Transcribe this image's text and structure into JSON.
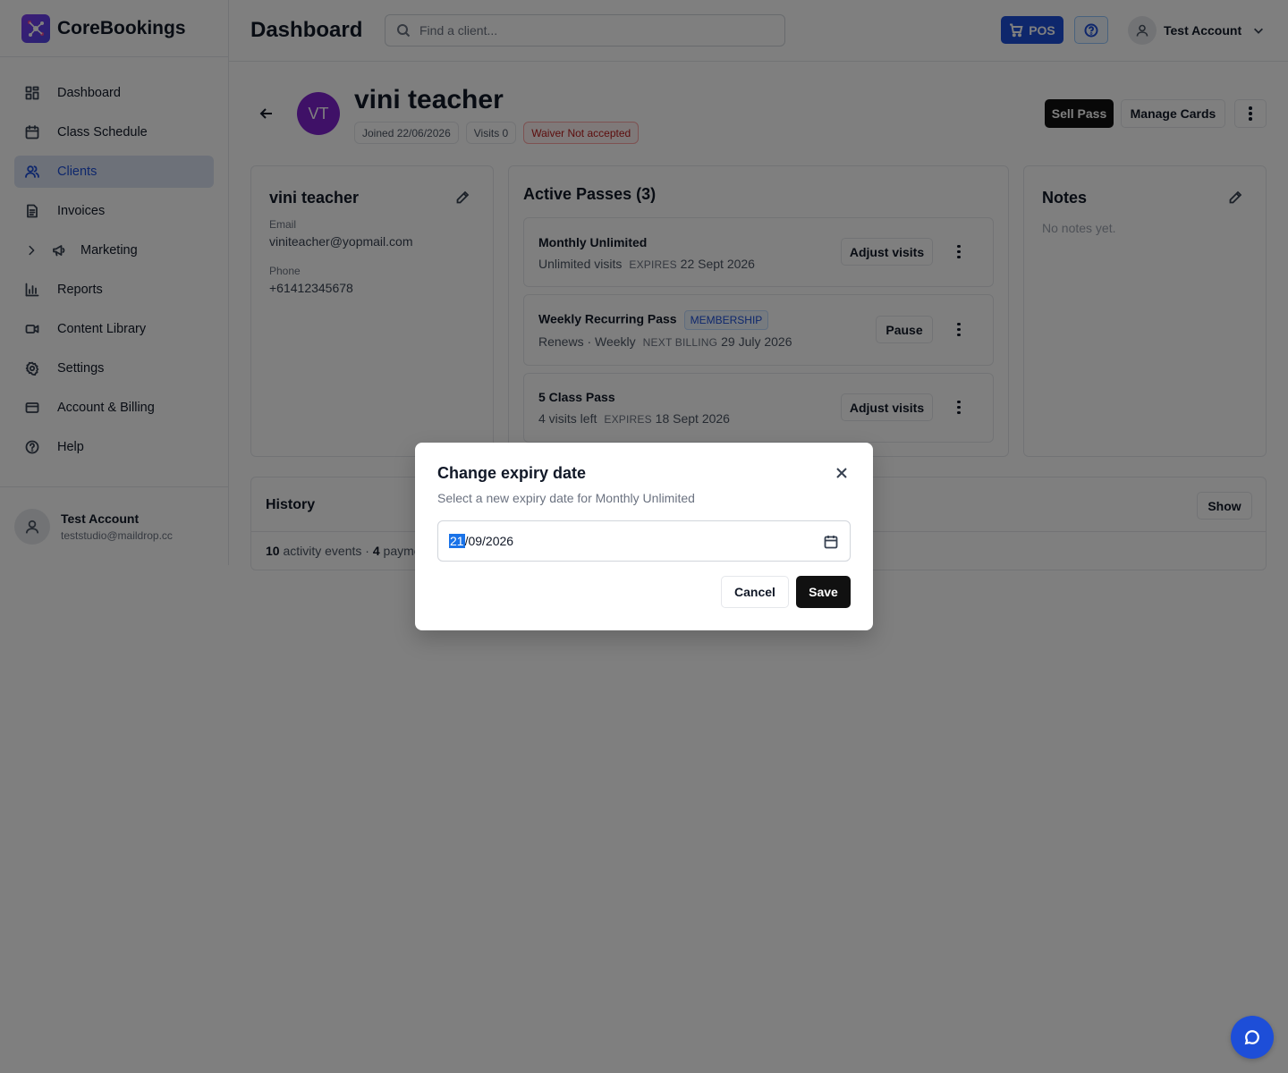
{
  "app": {
    "brand": "CoreBookings"
  },
  "sidebar": {
    "items": [
      {
        "label": "Dashboard",
        "icon": "dashboard-icon"
      },
      {
        "label": "Class Schedule",
        "icon": "calendar-icon"
      },
      {
        "label": "Clients",
        "icon": "users-icon",
        "active": true
      },
      {
        "label": "Invoices",
        "icon": "document-icon"
      },
      {
        "label": "Marketing",
        "icon": "megaphone-icon",
        "expandable": true
      },
      {
        "label": "Reports",
        "icon": "bar-chart-icon"
      },
      {
        "label": "Content Library",
        "icon": "video-icon"
      },
      {
        "label": "Settings",
        "icon": "gear-icon"
      },
      {
        "label": "Account & Billing",
        "icon": "credit-card-icon"
      },
      {
        "label": "Help",
        "icon": "help-circle-icon"
      }
    ],
    "user": {
      "name": "Test Account",
      "email": "teststudio@maildrop.cc"
    }
  },
  "header": {
    "title": "Dashboard",
    "search_placeholder": "Find a client...",
    "pos_label": "POS",
    "account_name": "Test Account"
  },
  "client": {
    "initials": "VT",
    "name": "vini teacher",
    "joined": "Joined 22/06/2026",
    "visits": "Visits 0",
    "waiver": "Waiver Not accepted",
    "sell_pass_label": "Sell Pass",
    "manage_cards_label": "Manage Cards",
    "email_label": "Email",
    "email": "viniteacher@yopmail.com",
    "phone_label": "Phone",
    "phone": "+61412345678"
  },
  "passes": {
    "title": "Active Passes (3)",
    "items": [
      {
        "name": "Monthly Unlimited",
        "meta": "Unlimited visits",
        "cap": "EXPIRES",
        "date": "22 Sept 2026",
        "action": "Adjust visits"
      },
      {
        "name": "Weekly Recurring Pass",
        "badge": "MEMBERSHIP",
        "meta": "Renews · Weekly",
        "cap": "NEXT BILLING",
        "date": "29 July 2026",
        "action": "Pause"
      },
      {
        "name": "5 Class Pass",
        "meta": "4 visits left",
        "cap": "EXPIRES",
        "date": "18 Sept 2026",
        "action": "Adjust visits"
      }
    ]
  },
  "notes": {
    "title": "Notes",
    "empty": "No notes yet."
  },
  "history": {
    "title": "History",
    "show_label": "Show",
    "events_count": "10",
    "events_label": " activity events · ",
    "payments_count": "4",
    "payments_label": " payme"
  },
  "modal": {
    "title": "Change expiry date",
    "subtitle": "Select a new expiry date for Monthly Unlimited",
    "date_day": "21",
    "date_rest": "/09/2026",
    "cancel_label": "Cancel",
    "save_label": "Save"
  },
  "colors": {
    "accent": "#1d4ed8",
    "avatar": "#7e22ce",
    "danger": "#b91c1c"
  }
}
